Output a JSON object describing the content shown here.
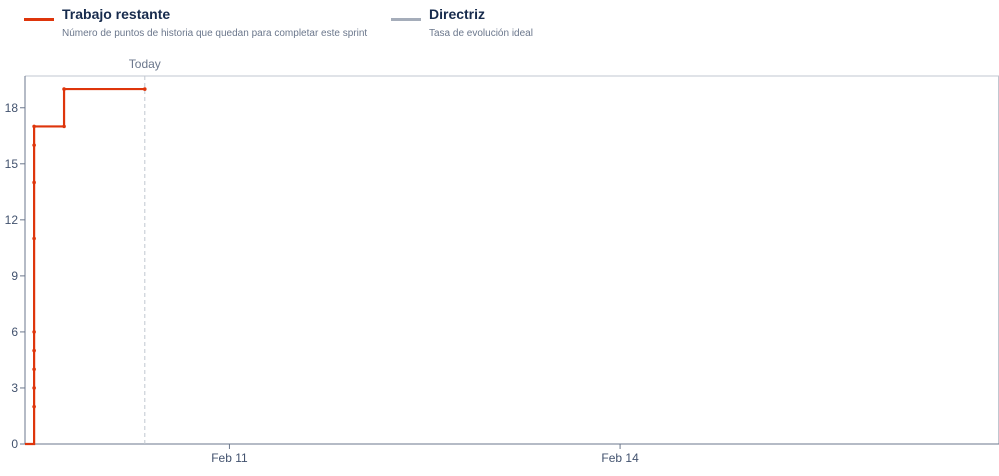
{
  "legend": {
    "items": [
      {
        "title": "Trabajo restante",
        "description": "Número de puntos de historia que quedan para completar este sprint",
        "color": "#de350b"
      },
      {
        "title": "Directriz",
        "description": "Tasa de evolución ideal",
        "color": "#a5adba"
      }
    ]
  },
  "today_label": "Today",
  "chart_data": {
    "type": "line",
    "x_axis": {
      "type": "date",
      "tick_labels": [
        "Feb 11",
        "Feb 14"
      ],
      "tick_values_days": [
        11,
        14
      ],
      "range_days": [
        9.43,
        16.91
      ]
    },
    "y_axis": {
      "range": [
        0,
        19.7
      ],
      "tick_values": [
        0,
        3,
        6,
        9,
        12,
        15,
        18
      ],
      "tick_labels": [
        "0",
        "3",
        "6",
        "9",
        "12",
        "15",
        "18"
      ]
    },
    "today_day": 10.35,
    "series": [
      {
        "name": "Trabajo restante",
        "color": "#de350b",
        "step": true,
        "points": [
          {
            "x": 9.43,
            "y": 0
          },
          {
            "x": 9.5,
            "y": 0
          },
          {
            "x": 9.5,
            "y": 2
          },
          {
            "x": 9.5,
            "y": 3
          },
          {
            "x": 9.5,
            "y": 4
          },
          {
            "x": 9.5,
            "y": 5
          },
          {
            "x": 9.5,
            "y": 6
          },
          {
            "x": 9.5,
            "y": 11
          },
          {
            "x": 9.5,
            "y": 14
          },
          {
            "x": 9.5,
            "y": 16
          },
          {
            "x": 9.5,
            "y": 17
          },
          {
            "x": 9.73,
            "y": 17
          },
          {
            "x": 9.73,
            "y": 19
          },
          {
            "x": 10.35,
            "y": 19
          }
        ]
      }
    ],
    "grid": false
  }
}
